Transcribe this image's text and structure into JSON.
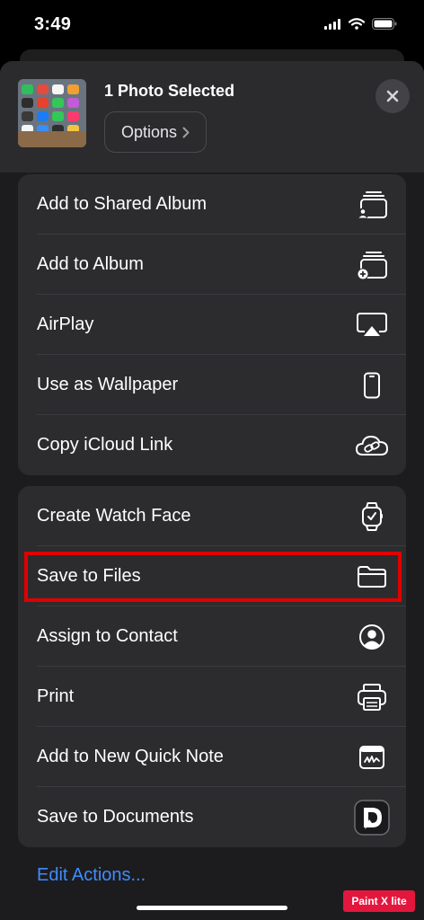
{
  "status_bar": {
    "time": "3:49"
  },
  "header": {
    "title": "1 Photo Selected",
    "options_label": "Options"
  },
  "group1": [
    {
      "label": "Add to Shared Album",
      "icon": "shared-album-icon"
    },
    {
      "label": "Add to Album",
      "icon": "add-album-icon"
    },
    {
      "label": "AirPlay",
      "icon": "airplay-icon"
    },
    {
      "label": "Use as Wallpaper",
      "icon": "phone-icon"
    },
    {
      "label": "Copy iCloud Link",
      "icon": "cloud-link-icon"
    }
  ],
  "group2": [
    {
      "label": "Create Watch Face",
      "icon": "watch-icon"
    },
    {
      "label": "Save to Files",
      "icon": "folder-icon"
    },
    {
      "label": "Assign to Contact",
      "icon": "contact-icon"
    },
    {
      "label": "Print",
      "icon": "printer-icon"
    },
    {
      "label": "Add to New Quick Note",
      "icon": "quick-note-icon"
    },
    {
      "label": "Save to Documents",
      "icon": "documents-app-icon"
    }
  ],
  "edit_actions_label": "Edit Actions...",
  "watermark": "Paint X lite",
  "colors": {
    "link": "#3f8cff",
    "highlight": "#e00000",
    "sheet": "#1c1c1e",
    "row_bg": "#2c2c2e"
  }
}
